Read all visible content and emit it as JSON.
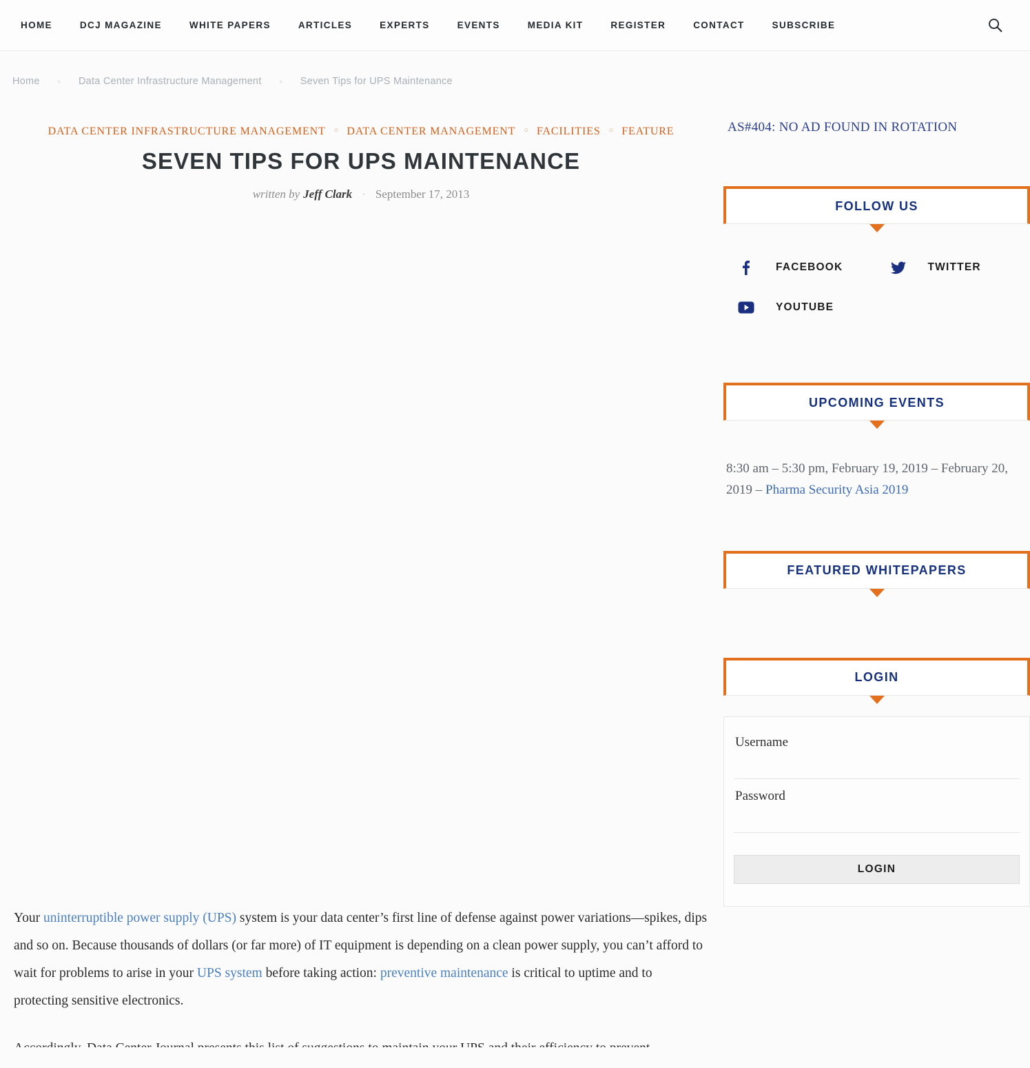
{
  "nav": {
    "items": [
      {
        "label": "HOME"
      },
      {
        "label": "DCJ MAGAZINE"
      },
      {
        "label": "WHITE PAPERS"
      },
      {
        "label": "ARTICLES"
      },
      {
        "label": "EXPERTS"
      },
      {
        "label": "EVENTS"
      },
      {
        "label": "MEDIA KIT"
      },
      {
        "label": "REGISTER"
      },
      {
        "label": "CONTACT"
      },
      {
        "label": "SUBSCRIBE"
      }
    ],
    "search_icon": "search-icon"
  },
  "breadcrumb": {
    "items": [
      {
        "label": "Home"
      },
      {
        "label": "Data Center Infrastructure Management"
      },
      {
        "label": "Seven Tips for UPS Maintenance"
      }
    ],
    "separator": "›"
  },
  "article": {
    "categories": [
      {
        "label": "DATA CENTER INFRASTRUCTURE MANAGEMENT"
      },
      {
        "label": "DATA CENTER MANAGEMENT"
      },
      {
        "label": "FACILITIES"
      },
      {
        "label": "FEATURE"
      }
    ],
    "category_separator": "○",
    "title": "SEVEN TIPS FOR UPS MAINTENANCE",
    "written_by_label": "written by",
    "author": "Jeff Clark",
    "byline_dot": "·",
    "date": "September 17, 2013",
    "paragraph_1": {
      "t1": "Your ",
      "a1": "uninterruptible power supply (UPS)",
      "t2": " system is your data center’s first line of defense against power variations—spikes, dips and so on. Because thousands of dollars (or far more) of IT equipment is depending on a clean power supply, you can’t afford to wait for problems to arise in your ",
      "a2": "UPS system",
      "t3": " before taking action: ",
      "a3": "preventive maintenance",
      "t4": " is critical to uptime and to protecting sensitive electronics."
    },
    "paragraph_2": {
      "t1": "Accordingly, Data Center Journal presents this list of suggestions to maintain your UPS and their efficiency to prevent downtime."
    }
  },
  "sidebar": {
    "ad_notice": "AS#404: NO AD FOUND IN ROTATION",
    "follow_us": {
      "title": "FOLLOW US",
      "socials": [
        {
          "label": "FACEBOOK",
          "icon": "facebook-icon"
        },
        {
          "label": "TWITTER",
          "icon": "twitter-icon"
        },
        {
          "label": "YOUTUBE",
          "icon": "youtube-icon"
        }
      ]
    },
    "upcoming_events": {
      "title": "UPCOMING EVENTS",
      "event_time": "8:30 am – 5:30 pm, February 19, 2019 – February 20, 2019 – ",
      "event_name": "Pharma Security Asia 2019"
    },
    "featured_whitepapers": {
      "title": "FEATURED WHITEPAPERS"
    },
    "login": {
      "title": "LOGIN",
      "username_label": "Username",
      "username_value": "",
      "password_label": "Password",
      "password_value": "",
      "submit_label": "LOGIN"
    }
  },
  "colors": {
    "accent_orange": "#e2701c",
    "heading_blue": "#15307d",
    "link_blue": "#4a7fc1",
    "category_orange": "#d3601a"
  }
}
